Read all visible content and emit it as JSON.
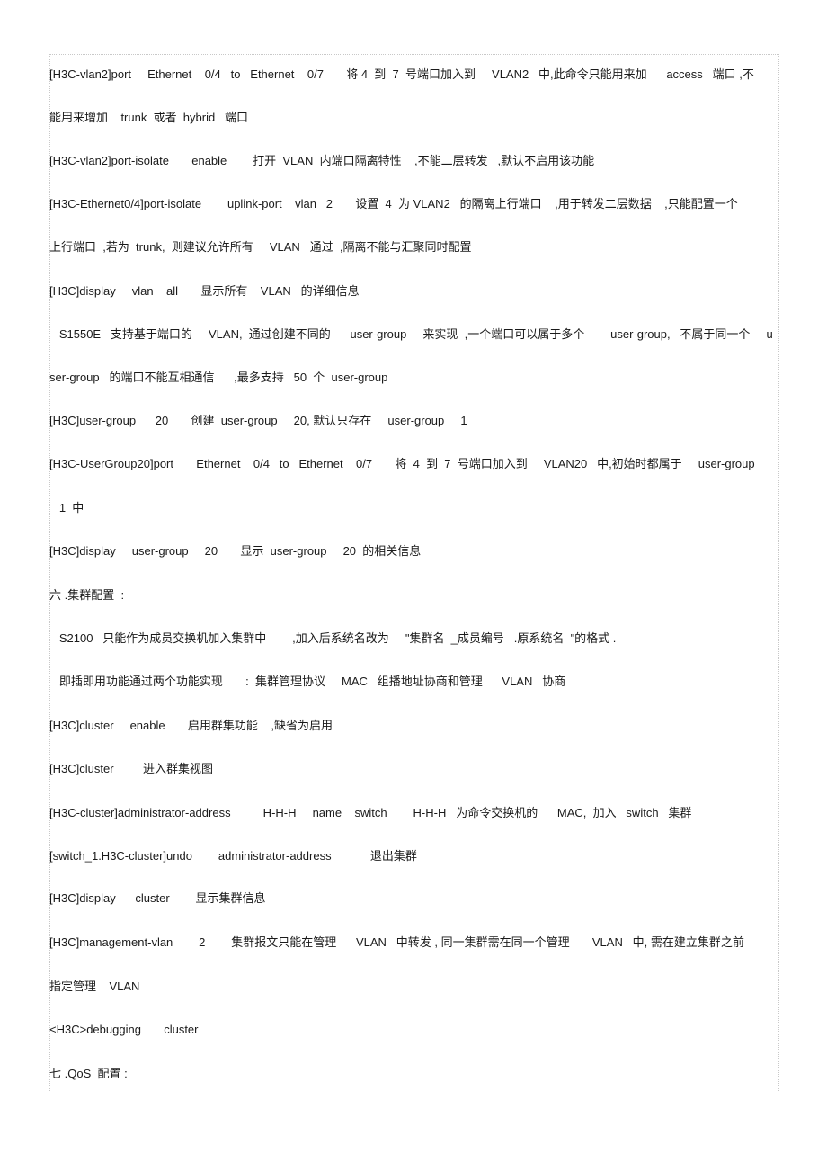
{
  "document": {
    "lines": [
      "[H3C-vlan2]port     Ethernet    0/4   to   Ethernet    0/7       将 4  到  7  号端口加入到     VLAN2   中,此命令只能用来加      access   端口 ,不",
      "能用来增加    trunk  或者  hybrid   端口",
      "[H3C-vlan2]port-isolate       enable        打开  VLAN  内端口隔离特性    ,不能二层转发   ,默认不启用该功能",
      "[H3C-Ethernet0/4]port-isolate        uplink-port    vlan   2       设置  4  为 VLAN2   的隔离上行端口    ,用于转发二层数据    ,只能配置一个",
      "上行端口  ,若为  trunk,  则建议允许所有     VLAN   通过  ,隔离不能与汇聚同时配置",
      "[H3C]display     vlan    all       显示所有    VLAN   的详细信息",
      "   S1550E   支持基于端口的     VLAN,  通过创建不同的      user-group     来实现  ,一个端口可以属于多个        user-group,   不属于同一个     u",
      "ser-group   的端口不能互相通信      ,最多支持   50  个  user-group",
      "[H3C]user-group      20       创建  user-group     20, 默认只存在     user-group     1",
      "[H3C-UserGroup20]port       Ethernet    0/4   to   Ethernet    0/7       将  4  到  7  号端口加入到     VLAN20   中,初始时都属于     user-group",
      "   1  中",
      "[H3C]display     user-group     20       显示  user-group     20  的相关信息",
      "六 .集群配置  :",
      "   S2100   只能作为成员交换机加入集群中        ,加入后系统名改为     \"集群名  _成员编号   .原系统名  \"的格式 .",
      "   即插即用功能通过两个功能实现       :  集群管理协议     MAC   组播地址协商和管理      VLAN   协商",
      "[H3C]cluster     enable       启用群集功能    ,缺省为启用",
      "[H3C]cluster         进入群集视图",
      "[H3C-cluster]administrator-address          H-H-H     name    switch        H-H-H   为命令交换机的      MAC,  加入   switch   集群",
      "[switch_1.H3C-cluster]undo        administrator-address            退出集群",
      "[H3C]display      cluster        显示集群信息",
      "[H3C]management-vlan        2        集群报文只能在管理      VLAN   中转发 , 同一集群需在同一个管理       VLAN   中, 需在建立集群之前",
      "指定管理    VLAN",
      "<H3C>debugging       cluster",
      "七 .QoS  配置 :"
    ]
  }
}
